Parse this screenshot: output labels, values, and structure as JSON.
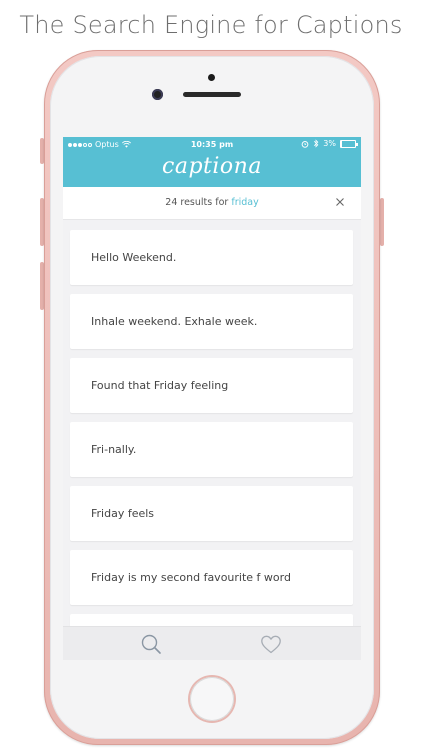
{
  "headline": "The Search Engine for Captions",
  "device": {
    "status_bar": {
      "carrier": "Optus",
      "time": "10:35 pm",
      "battery": "3%",
      "battery_level": 0.03
    }
  },
  "app": {
    "logo_text": "captiona",
    "colors": {
      "header": "#57bfd3",
      "accent": "#57bfd3"
    },
    "results_bar": {
      "prefix": "24 results for",
      "query": "friday",
      "close_icon": "close-icon"
    },
    "results": [
      {
        "text": "Hello Weekend."
      },
      {
        "text": "Inhale weekend. Exhale week."
      },
      {
        "text": "Found that Friday feeling"
      },
      {
        "text": "Fri-nally."
      },
      {
        "text": "Friday feels"
      },
      {
        "text": "Friday is my second favourite f word"
      },
      {
        "text": ""
      }
    ],
    "tab_bar": {
      "tabs": [
        {
          "icon": "search-icon"
        },
        {
          "icon": "heart-icon"
        }
      ]
    }
  }
}
